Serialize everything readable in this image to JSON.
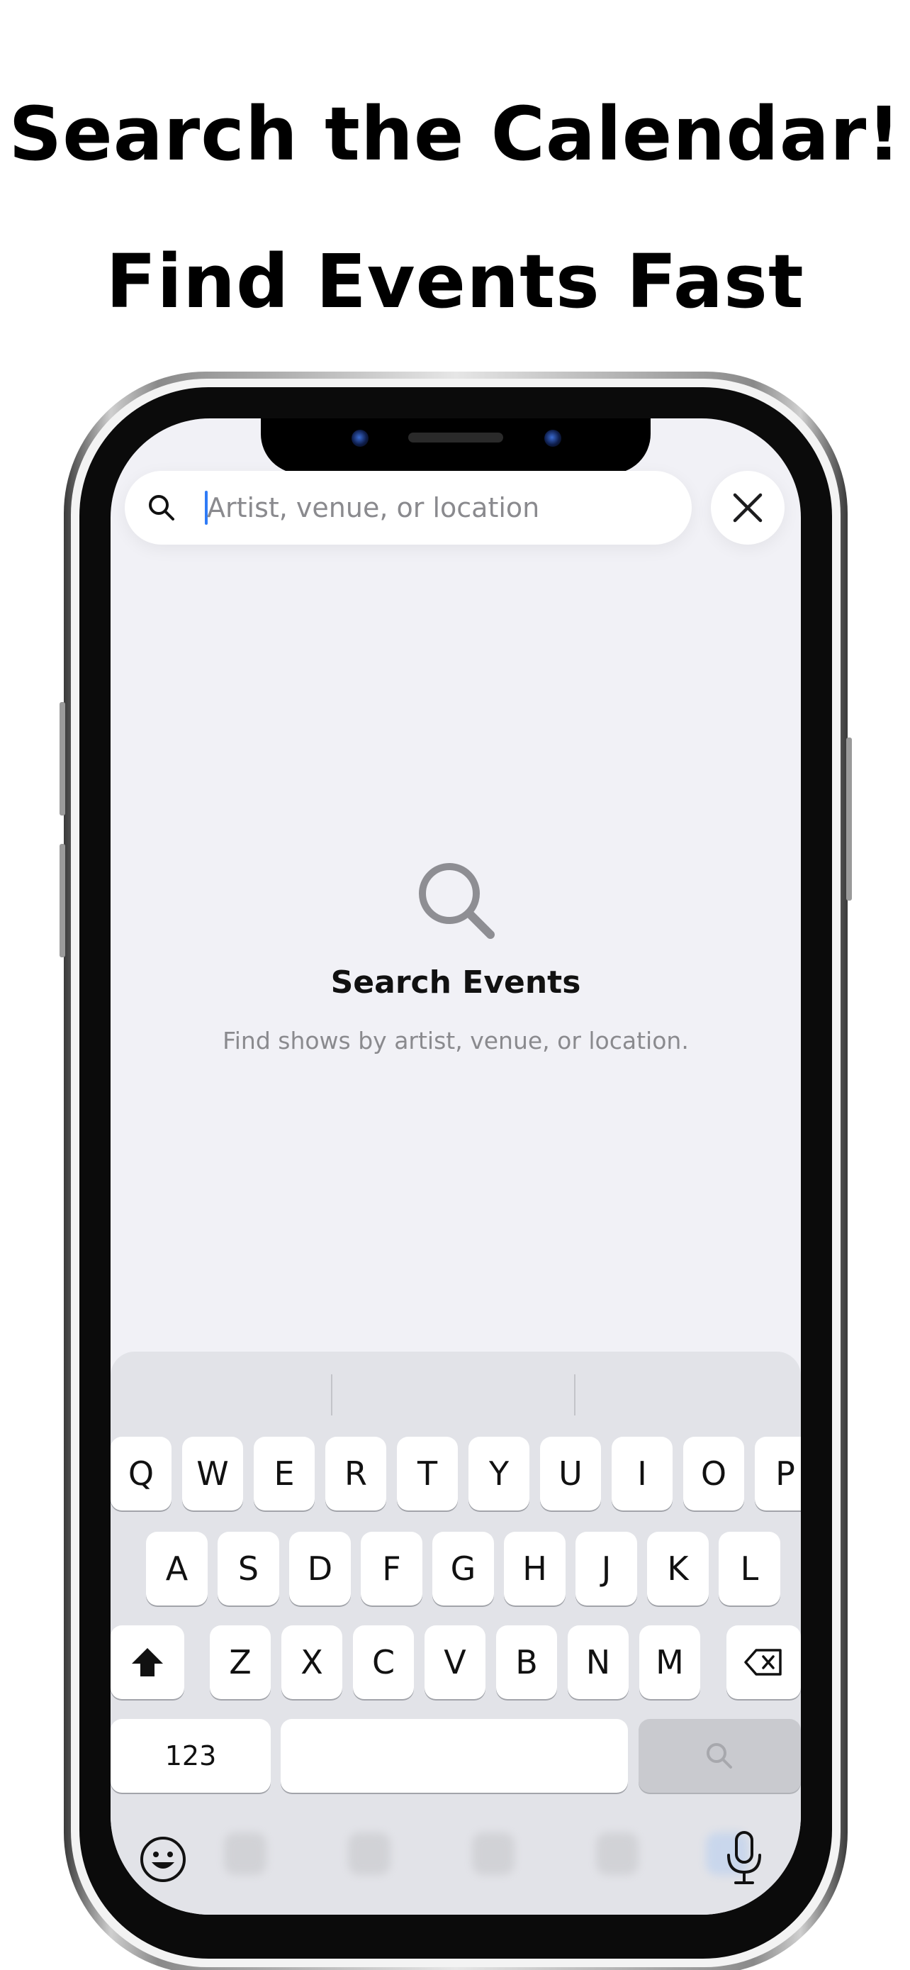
{
  "headline": {
    "line1": "Search the Calendar!",
    "line2": "Find Events Fast"
  },
  "search": {
    "placeholder": "Artist, venue, or location",
    "value": ""
  },
  "icons": {
    "search": "magnifying-glass-icon",
    "close": "xmark-icon",
    "empty_state": "magnifying-glass-icon",
    "shift": "shift-arrow-icon",
    "delete": "delete-backspace-icon",
    "keyboard_search": "magnifying-glass-icon",
    "emoji": "smiley-face-icon",
    "dictation": "microphone-icon"
  },
  "empty_state": {
    "title": "Search Events",
    "subtitle": "Find shows by artist, venue, or location."
  },
  "keyboard": {
    "row1": [
      "Q",
      "W",
      "E",
      "R",
      "T",
      "Y",
      "U",
      "I",
      "O",
      "P"
    ],
    "row2": [
      "A",
      "S",
      "D",
      "F",
      "G",
      "H",
      "J",
      "K",
      "L"
    ],
    "row3": [
      "Z",
      "X",
      "C",
      "V",
      "B",
      "N",
      "M"
    ],
    "numbers_key": "123"
  },
  "colors": {
    "screen_bg": "#f1f1f6",
    "caret": "#2f7bf6",
    "keyboard_bg": "#e2e3e8",
    "placeholder_text": "#8a8a8e"
  }
}
